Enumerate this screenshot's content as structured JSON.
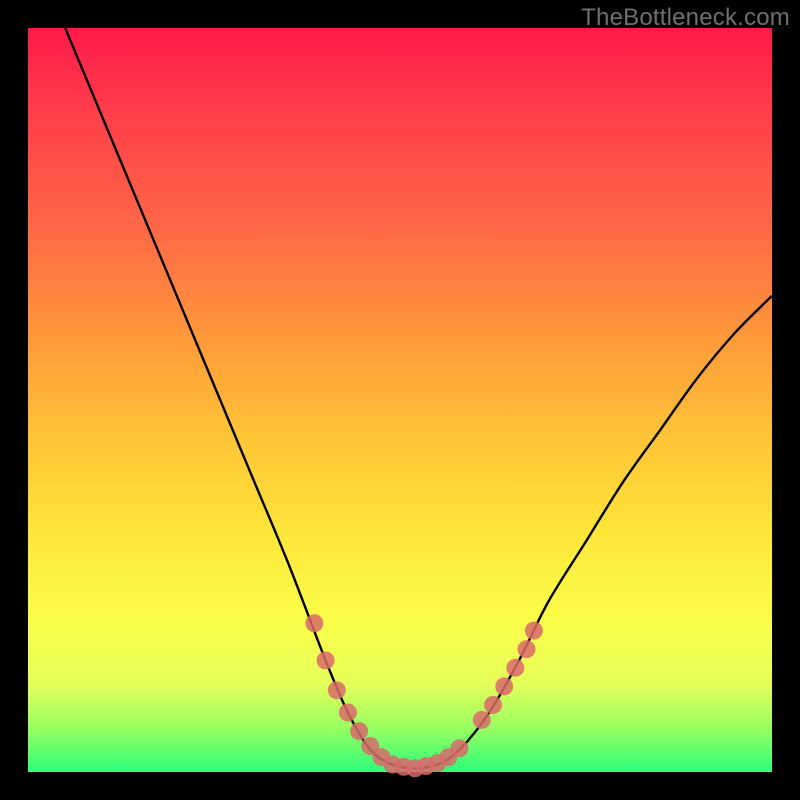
{
  "watermark": "TheBottleneck.com",
  "chart_data": {
    "type": "line",
    "title": "",
    "xlabel": "",
    "ylabel": "",
    "xlim": [
      0,
      100
    ],
    "ylim": [
      0,
      100
    ],
    "series": [
      {
        "name": "bottleneck-curve",
        "x": [
          5,
          10,
          15,
          20,
          25,
          30,
          35,
          40,
          43,
          46,
          49,
          52,
          55,
          58,
          62,
          66,
          70,
          75,
          80,
          85,
          90,
          95,
          100
        ],
        "y": [
          100,
          88,
          76,
          64,
          52,
          40,
          28,
          15,
          8,
          3,
          1,
          0.5,
          1,
          3,
          8,
          15,
          23,
          31,
          39,
          46,
          53,
          59,
          64
        ]
      }
    ],
    "markers": {
      "name": "highlight-dots",
      "color": "#d96a6a",
      "points": [
        {
          "x": 38.5,
          "y": 20
        },
        {
          "x": 40.0,
          "y": 15
        },
        {
          "x": 41.5,
          "y": 11
        },
        {
          "x": 43.0,
          "y": 8
        },
        {
          "x": 44.5,
          "y": 5.5
        },
        {
          "x": 46.0,
          "y": 3.5
        },
        {
          "x": 47.5,
          "y": 2
        },
        {
          "x": 49.0,
          "y": 1
        },
        {
          "x": 50.5,
          "y": 0.7
        },
        {
          "x": 52.0,
          "y": 0.5
        },
        {
          "x": 53.5,
          "y": 0.8
        },
        {
          "x": 55.0,
          "y": 1.2
        },
        {
          "x": 56.5,
          "y": 2
        },
        {
          "x": 58.0,
          "y": 3.2
        },
        {
          "x": 61.0,
          "y": 7
        },
        {
          "x": 62.5,
          "y": 9
        },
        {
          "x": 64.0,
          "y": 11.5
        },
        {
          "x": 65.5,
          "y": 14
        },
        {
          "x": 67.0,
          "y": 16.5
        },
        {
          "x": 68.0,
          "y": 19
        }
      ]
    },
    "background_gradient": {
      "top": "#ff1a48",
      "bottom": "#2cff7a"
    }
  }
}
